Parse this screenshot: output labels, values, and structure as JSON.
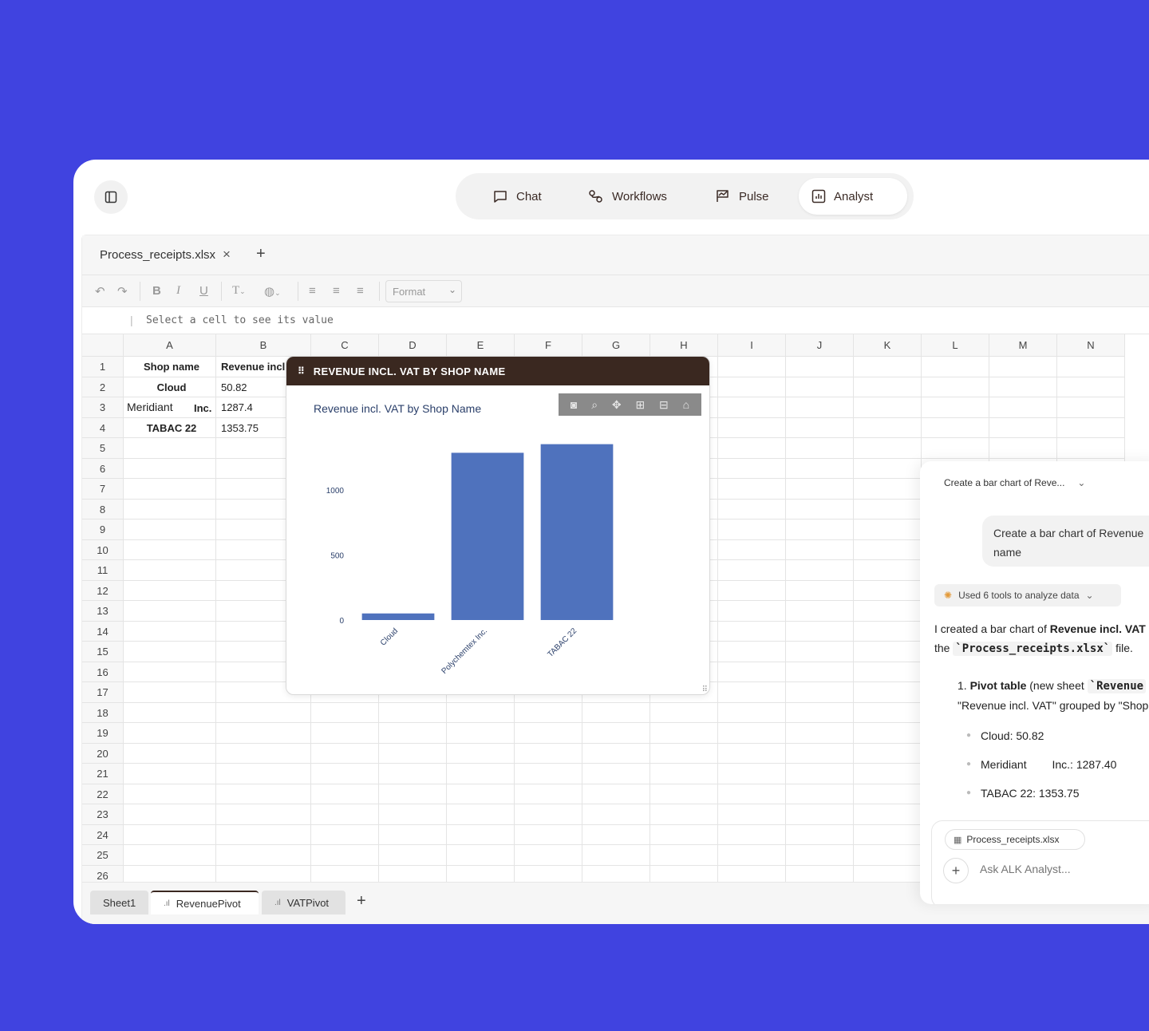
{
  "nav": {
    "items": [
      {
        "label": "Chat",
        "icon": "chat-icon"
      },
      {
        "label": "Workflows",
        "icon": "workflows-icon"
      },
      {
        "label": "Pulse",
        "icon": "pulse-icon"
      },
      {
        "label": "Analyst",
        "icon": "analyst-icon",
        "active": true
      }
    ]
  },
  "file_tab": {
    "label": "Process_receipts.xlsx",
    "close": "×",
    "add": "+"
  },
  "toolbar": {
    "format_label": "Format"
  },
  "formula_bar": {
    "hint": "Select a cell to see its value"
  },
  "columns": [
    "A",
    "B",
    "C",
    "D",
    "E",
    "F",
    "G",
    "H",
    "I",
    "J",
    "K",
    "L",
    "M",
    "N"
  ],
  "rows": [
    "1",
    "2",
    "3",
    "4",
    "5",
    "6",
    "7",
    "8",
    "9",
    "10",
    "11",
    "12",
    "13",
    "14",
    "15",
    "16",
    "17",
    "18",
    "19",
    "20",
    "21",
    "22",
    "23",
    "24",
    "25",
    "26"
  ],
  "cells": {
    "header": [
      "Shop name",
      "Revenue incl."
    ],
    "data": [
      {
        "a": "Cloud",
        "b": "50.82"
      },
      {
        "a": "Meridiant",
        "a2": "Inc.",
        "b": "1287.4"
      },
      {
        "a": "TABAC 22",
        "b": "1353.75"
      }
    ]
  },
  "sheet_tabs": [
    {
      "label": "Sheet1"
    },
    {
      "label": "RevenuePivot",
      "active": true
    },
    {
      "label": "VATPivot"
    }
  ],
  "sheet_add": "+",
  "chart_panel": {
    "header": "REVENUE INCL. VAT BY SHOP NAME"
  },
  "chart_data": {
    "type": "bar",
    "title": "Revenue incl. VAT by Shop Name",
    "categories": [
      "Cloud",
      "Polychemtex Inc.",
      "TABAC 22"
    ],
    "values": [
      50.82,
      1287.4,
      1353.75
    ],
    "yticks": [
      "0",
      "500",
      "1000"
    ],
    "ylim": [
      0,
      1380
    ],
    "color": "#4f72bd",
    "grid": false
  },
  "chat": {
    "title": "Create a bar chart of Reve...",
    "user_message_line1": "Create a bar chart of Revenue",
    "user_message_line2": "name",
    "tools_pill": "Used 6 tools to analyze data",
    "answer_line1_a": "I created a bar chart of ",
    "answer_line1_b": "Revenue incl. VAT",
    "answer_line2_a": "the ",
    "answer_line2_code": "`Process_receipts.xlsx`",
    "answer_line2_b": " file.",
    "list_num": "1.",
    "list_bold": "Pivot table",
    "list_text": " (new sheet ",
    "list_code": "`Revenue",
    "list_line2": "\"Revenue incl. VAT\" grouped by \"Shop",
    "bullets": [
      {
        "text": "Cloud: 50.82"
      },
      {
        "text_a": "Meridiant",
        "text_b": "Inc.: 1287.40"
      },
      {
        "text": "TABAC 22: 1353.75"
      }
    ],
    "attachment": "Process_receipts.xlsx",
    "input_placeholder": "Ask ALK Analyst..."
  }
}
